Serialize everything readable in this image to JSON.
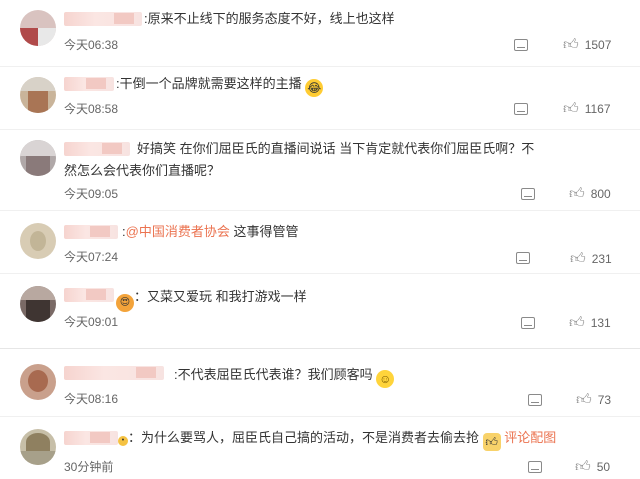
{
  "comments": [
    {
      "text": "原来不止线下的服务态度不好，线上也这样",
      "time": "今天06:38",
      "likes": "1507"
    },
    {
      "text": "干倒一个品牌就需要这样的主播",
      "emoji": "laughing-tears-emoji",
      "time": "今天08:58",
      "likes": "1167"
    },
    {
      "text": "好搞笑 在你们屈臣氏的直播间说话 当下肯定就代表你们屈臣氏啊？不然怎么会代表你们直播呢？",
      "time": "今天09:05",
      "likes": "800"
    },
    {
      "mention": "@中国消费者协会",
      "text": " 这事得管管",
      "time": "今天07:24",
      "likes": "231"
    },
    {
      "text": "又菜又爱玩 和我打游戏一样",
      "time": "今天09:01",
      "likes": "131"
    },
    {
      "text": "不代表屈臣氏代表谁？我们顾客吗",
      "emoji": "smile-emoji",
      "time": "今天08:16",
      "likes": "73"
    },
    {
      "text": "为什么要骂人，屈臣氏自己搞的活动，不是消费者去偷去抢",
      "emoji": "thumbs-up-emoji",
      "link": "评论配图",
      "time": "30分钟前",
      "likes": "50"
    }
  ],
  "colors": {
    "mention": "#eb7350",
    "text": "#333333",
    "meta": "#666666"
  }
}
